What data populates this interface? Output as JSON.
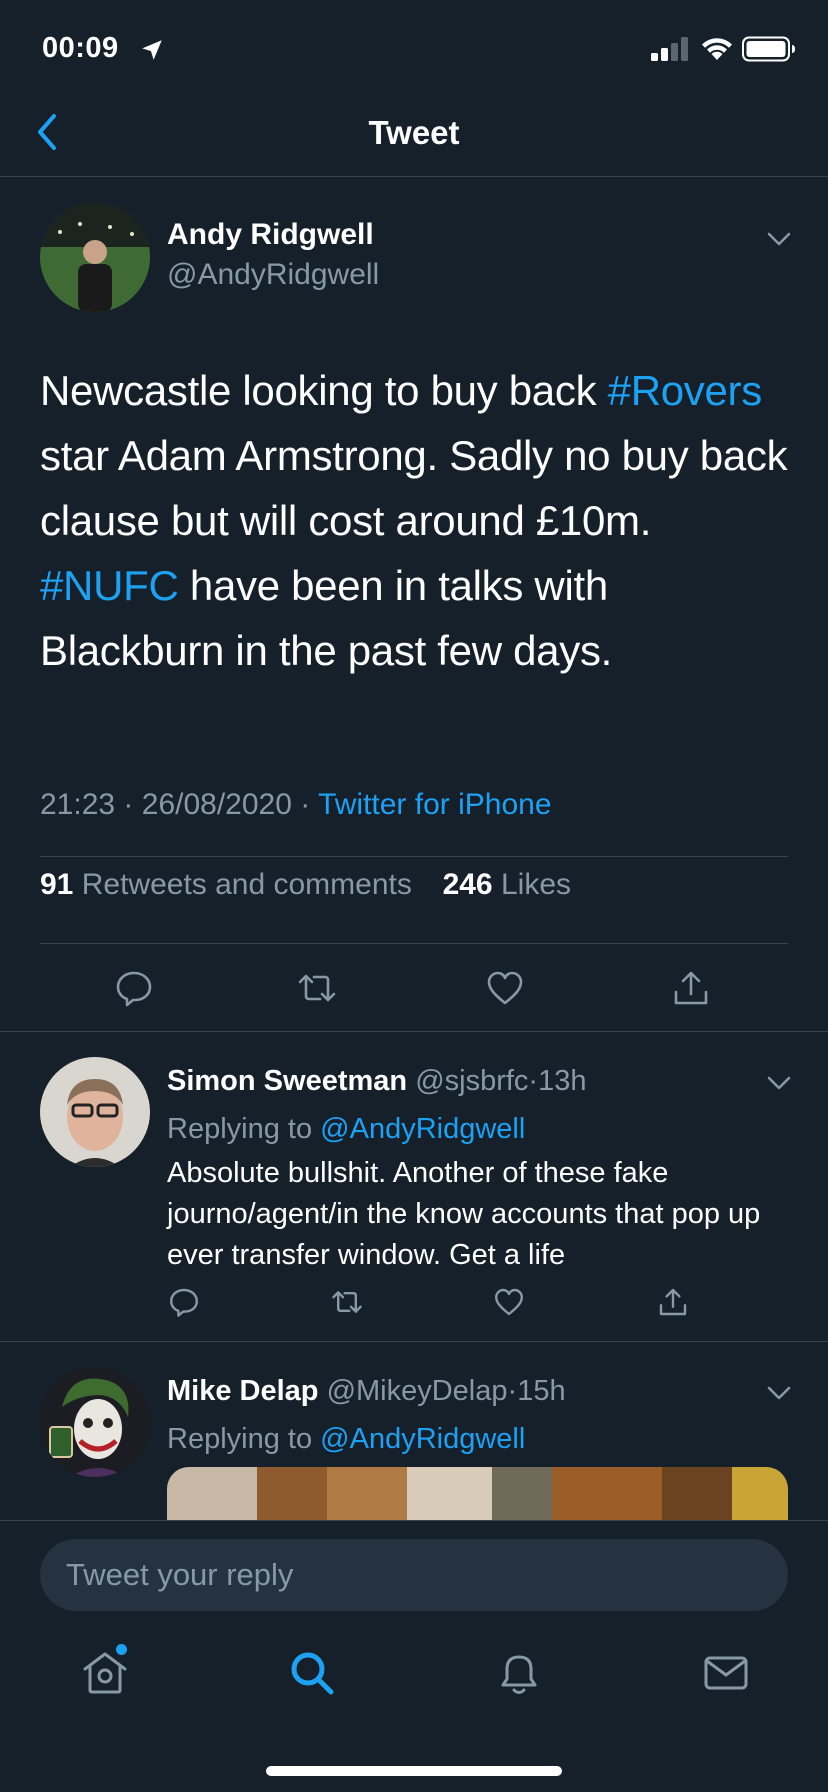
{
  "status_bar": {
    "time": "00:09"
  },
  "nav": {
    "title": "Tweet"
  },
  "tweet": {
    "author_name": "Andy Ridgwell",
    "author_handle": "@AndyRidgwell",
    "text_parts": {
      "p1": "Newcastle looking to buy back ",
      "hashtag1": "#Rovers",
      "p2": " star Adam Armstrong. Sadly no buy back clause but will cost around £10m. ",
      "hashtag2": "#NUFC",
      "p3": " have been in talks with Blackburn in the past few days."
    },
    "time": "21:23",
    "date": "26/08/2020",
    "separator": "·",
    "source": "Twitter for iPhone",
    "retweets_count": "91",
    "retweets_label": "Retweets and comments",
    "likes_count": "246",
    "likes_label": "Likes"
  },
  "replies": [
    {
      "name": "Simon Sweetman",
      "handle": "@sjsbrfc",
      "age": "13h",
      "replying_label": "Replying to",
      "replying_handle": "@AndyRidgwell",
      "text": "Absolute bullshit. Another of these fake journo/agent/in the know accounts that pop up ever transfer window. Get a life"
    },
    {
      "name": "Mike Delap",
      "handle": "@MikeyDelap",
      "age": "15h",
      "replying_label": "Replying to",
      "replying_handle": "@AndyRidgwell"
    }
  ],
  "composer": {
    "placeholder": "Tweet your reply"
  },
  "tabbar": {
    "items": [
      "home-icon",
      "search-icon",
      "notifications-icon",
      "messages-icon"
    ],
    "active": "search-icon"
  },
  "colors": {
    "background": "#15202b",
    "accent": "#1da1f2",
    "muted": "#8899a6",
    "divider": "#38444d"
  }
}
